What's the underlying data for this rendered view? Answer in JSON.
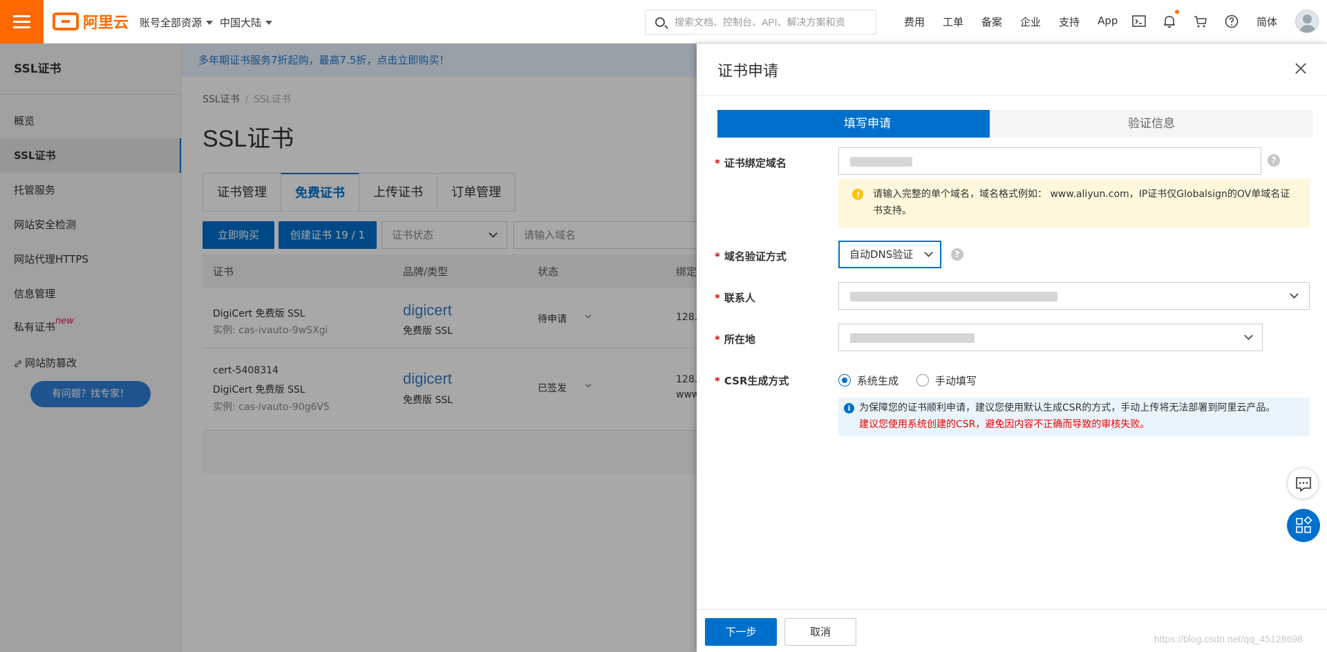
{
  "topbar": {
    "brand": "阿里云",
    "account_scope": "账号全部资源",
    "region": "中国大陆",
    "search_placeholder": "搜索文档、控制台、API、解决方案和资",
    "nav": [
      "费用",
      "工单",
      "备案",
      "企业",
      "支持",
      "App"
    ],
    "language": "简体"
  },
  "sidebar": {
    "title": "SSL证书",
    "items": [
      {
        "label": "概览"
      },
      {
        "label": "SSL证书"
      },
      {
        "label": "托管服务"
      },
      {
        "label": "网站安全检测"
      },
      {
        "label": "网站代理HTTPS"
      },
      {
        "label": "信息管理"
      },
      {
        "label": "私有证书",
        "badge": "new"
      },
      {
        "label": "网站防篡改"
      }
    ],
    "help_button": "有问题？找专家！"
  },
  "main": {
    "promo": "多年期证书服务7折起购，最高7.5折，点击立即购买！",
    "breadcrumb": [
      "SSL证书",
      "SSL证书"
    ],
    "title": "SSL证书",
    "tabs": [
      "证书管理",
      "免费证书",
      "上传证书",
      "订单管理"
    ],
    "buy_button": "立即购买",
    "create_button": "创建证书 19 / 1",
    "status_filter": "证书状态",
    "domain_placeholder": "请输入域名",
    "table": {
      "headers": [
        "证书",
        "品牌/类型",
        "状态",
        "绑定"
      ],
      "rows": [
        {
          "name": "",
          "product": "DigiCert 免费版 SSL",
          "instance": "实例: cas-ivauto-9wSXgi",
          "brand": "digicert",
          "type": "免费版 SSL",
          "status": "待申请",
          "bind": "128."
        },
        {
          "name": "cert-5408314",
          "product": "DigiCert 免费版 SSL",
          "instance": "实例: cas-ivauto-90g6V5",
          "brand": "digicert",
          "type": "免费版 SSL",
          "status": "已签发",
          "bind": "128.",
          "bind2": "www"
        }
      ]
    }
  },
  "drawer": {
    "title": "证书申请",
    "steps": [
      "填写申请",
      "验证信息"
    ],
    "fields": {
      "domain_label": "证书绑定域名",
      "domain_tip": "请输入完整的单个域名，域名格式例如： www.aliyun.com，IP证书仅Globalsign的OV单域名证书支持。",
      "verify_label": "域名验证方式",
      "verify_value": "自动DNS验证",
      "contact_label": "联系人",
      "location_label": "所在地",
      "csr_label": "CSR生成方式",
      "csr_options": [
        "系统生成",
        "手动填写"
      ],
      "csr_info": "为保障您的证书顺利申请，建议您使用默认生成CSR的方式，手动上传将无法部署到阿里云产品。",
      "csr_warning": "建议您使用系统创建的CSR，避免因内容不正确而导致的审核失败。"
    },
    "next_button": "下一步",
    "cancel_button": "取消",
    "watermark": "https://blog.csdn.net/qq_45128698"
  },
  "colors": {
    "accent": "#0070cc",
    "brand": "#ff6a00",
    "required": "#e00000"
  }
}
